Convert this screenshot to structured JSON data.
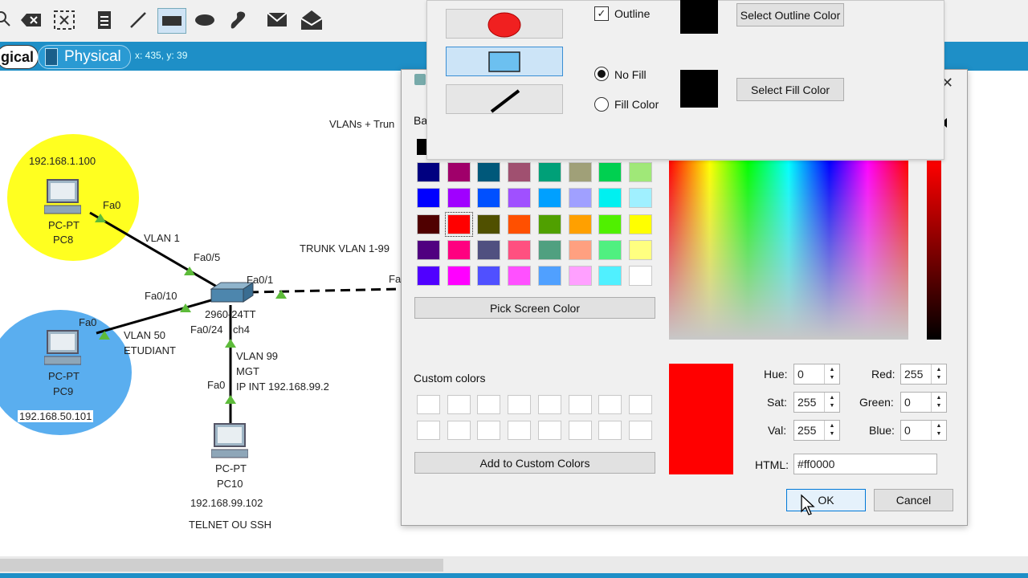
{
  "toolbar": {
    "icons": [
      "search-icon",
      "delete-icon",
      "resize-icon",
      "note-icon",
      "line-icon",
      "rectangle-icon",
      "ellipse-icon",
      "freeform-icon",
      "mail-icon",
      "open-mail-icon"
    ]
  },
  "modebar": {
    "logical_label": "gical",
    "physical_label": "Physical",
    "coords": "x: 435, y: 39"
  },
  "canvas": {
    "pc8": {
      "ip": "192.168.1.100",
      "type": "PC-PT",
      "name": "PC8",
      "port": "Fa0"
    },
    "pc9": {
      "port": "Fa0",
      "type": "PC-PT",
      "name": "PC9",
      "ip": "192.168.50.101"
    },
    "pc10": {
      "port": "Fa0",
      "type": "PC-PT",
      "name": "PC10",
      "ip": "192.168.99.102",
      "note": "TELNET OU SSH"
    },
    "switch": {
      "model": "2960-24TT",
      "name_partial": "ch4"
    },
    "labels": {
      "vlan1": "VLAN 1",
      "fa05": "Fa0/5",
      "fa01": "Fa0/1",
      "fa010": "Fa0/10",
      "fa024": "Fa0/24",
      "vlan50": "VLAN 50",
      "etudiant": "ETUDIANT",
      "vlan99": "VLAN 99",
      "mgt": "MGT",
      "ipint": "IP INT 192.168.99.2",
      "trunk": "TRUNK VLAN 1-99",
      "fa_right": "Fa",
      "vlans_trunk": "VLANs + Trun"
    }
  },
  "palette": {
    "outline_label": "Outline",
    "outline_checked": true,
    "select_outline": "Select Outline Color",
    "no_fill_label": "No Fill",
    "fill_color_label": "Fill Color",
    "select_fill": "Select Fill Color",
    "selected_fill_option": "No Fill",
    "outline_color": "#000000",
    "fill_color": "#000000"
  },
  "dialog": {
    "basic_colors_label_partial": "Ba",
    "basic_colors": [
      [
        "#000080",
        "#a0006a",
        "#00587a",
        "#a05070",
        "#00a078",
        "#a0a078",
        "#00d050",
        "#a0e878"
      ],
      [
        "#0000ff",
        "#a000ff",
        "#0050ff",
        "#a050ff",
        "#00a0ff",
        "#a0a0ff",
        "#00f0f0",
        "#a0f0ff"
      ],
      [
        "#500000",
        "#ff0000",
        "#505000",
        "#ff5000",
        "#50a000",
        "#ffa000",
        "#50f000",
        "#ffff00"
      ],
      [
        "#500080",
        "#ff0080",
        "#505080",
        "#ff5080",
        "#50a080",
        "#ffa080",
        "#50f080",
        "#ffff80"
      ],
      [
        "#5000ff",
        "#ff00ff",
        "#5050ff",
        "#ff50ff",
        "#50a0ff",
        "#ffa0ff",
        "#50f0ff",
        "#ffffff"
      ]
    ],
    "pick_screen": "Pick Screen Color",
    "custom_colors_label": "Custom colors",
    "add_custom": "Add to Custom Colors",
    "current_color": "#ff0000",
    "hue_label": "Hue:",
    "hue": "0",
    "sat_label": "Sat:",
    "sat": "255",
    "val_label": "Val:",
    "val": "255",
    "red_label": "Red:",
    "red": "255",
    "green_label": "Green:",
    "green": "0",
    "blue_label": "Blue:",
    "blue": "0",
    "html_label": "HTML:",
    "html_value": "#ff0000",
    "ok": "OK",
    "cancel": "Cancel",
    "close_glyph": "✕"
  }
}
